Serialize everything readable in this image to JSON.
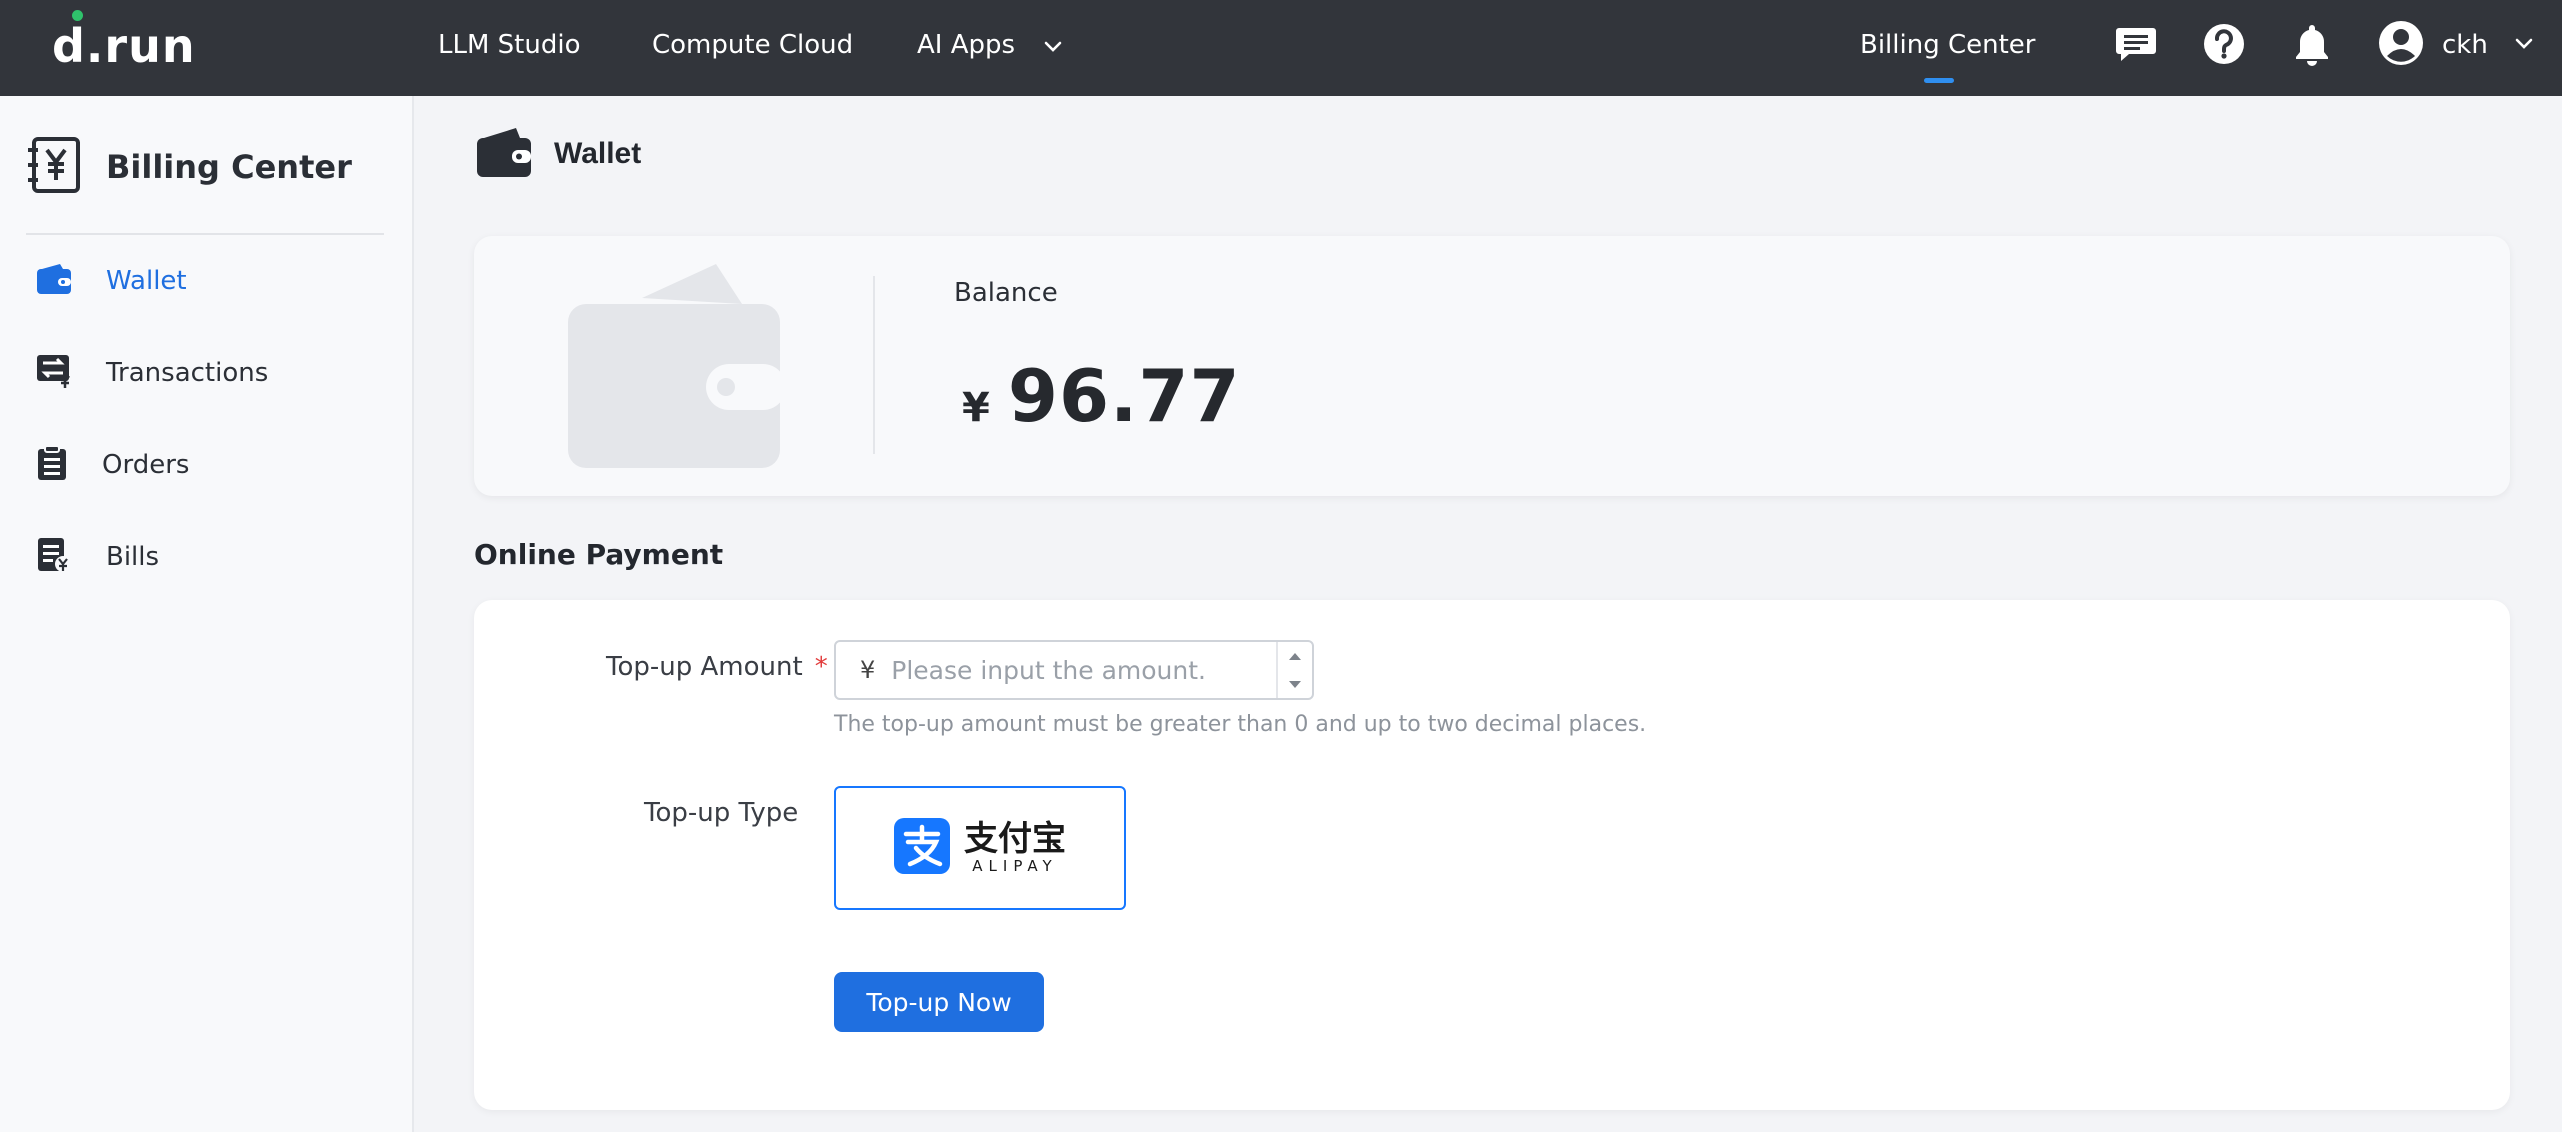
{
  "logo": {
    "text": "d.run"
  },
  "topnav": {
    "items": [
      {
        "label": "LLM Studio"
      },
      {
        "label": "Compute Cloud"
      },
      {
        "label": "AI Apps"
      }
    ],
    "billing_label": "Billing Center",
    "user_name": "ckh",
    "icons": [
      "chat-icon",
      "help-icon",
      "bell-icon",
      "user-avatar-icon",
      "chevron-down-icon"
    ]
  },
  "sidebar": {
    "title": "Billing Center",
    "items": [
      {
        "label": "Wallet",
        "icon": "wallet-icon",
        "active": true
      },
      {
        "label": "Transactions",
        "icon": "transactions-icon",
        "active": false
      },
      {
        "label": "Orders",
        "icon": "orders-icon",
        "active": false
      },
      {
        "label": "Bills",
        "icon": "bills-icon",
        "active": false
      }
    ]
  },
  "main": {
    "page_title": "Wallet",
    "balance": {
      "label": "Balance",
      "currency": "¥",
      "amount": "96.77"
    },
    "online_payment": {
      "title": "Online Payment",
      "amount_label": "Top-up Amount",
      "required_mark": "*",
      "currency": "¥",
      "amount_value": "",
      "amount_placeholder": "Please input the amount.",
      "hint": "The top-up amount must be greater than 0 and up to two decimal places.",
      "type_label": "Top-up Type",
      "payment_method": {
        "cn": "支付宝",
        "en": "ALIPAY",
        "selected": true
      },
      "submit_label": "Top-up Now"
    }
  },
  "colors": {
    "topbar": "#32353b",
    "accent": "#1f6fe0",
    "alipay": "#1677ff"
  }
}
